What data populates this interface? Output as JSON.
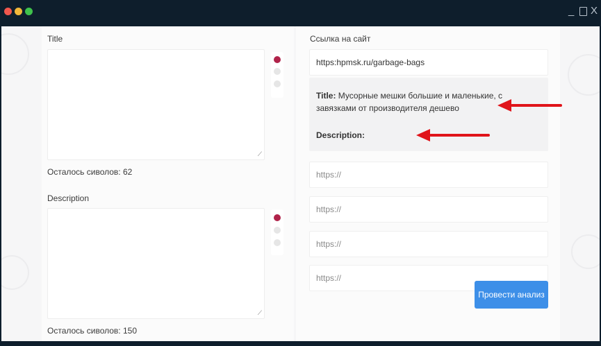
{
  "window": {
    "controls": {
      "minimize": "_",
      "close": "X"
    }
  },
  "left": {
    "title_label": "Title",
    "title_counter": "Осталось сиволов: 62",
    "description_label": "Description",
    "description_counter": "Осталось сиволов: 150"
  },
  "right": {
    "site_label": "Ссылка на сайт",
    "site_url": "https:hpmsk.ru/garbage-bags",
    "preview": {
      "title_key": "Title:",
      "title_value": "Мусорные мешки большие и маленькие, с завязками от производителя дешево",
      "description_key": "Description:"
    },
    "url_fields": [
      "https://",
      "https://",
      "https://",
      "https://"
    ],
    "analyze_button": "Провести анализ"
  },
  "colors": {
    "titlebar": "#0e1e2c",
    "accent_button": "#3d8fe8",
    "active_dot": "#b0234a",
    "annotation_arrow": "#e0141a"
  }
}
